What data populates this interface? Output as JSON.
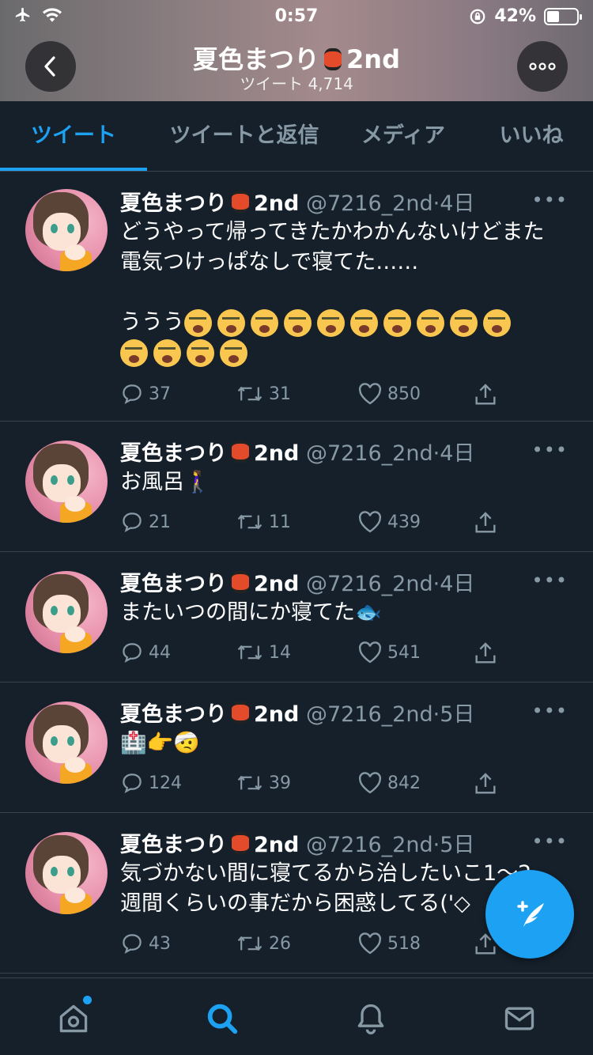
{
  "status_bar": {
    "time": "0:57",
    "battery_percent": "42%",
    "battery_level": 0.42
  },
  "header": {
    "title": "夏色まつり",
    "title_suffix": "2nd",
    "subtitle": "ツイート 4,714"
  },
  "tabs": [
    {
      "label": "ツイート",
      "active": true
    },
    {
      "label": "ツイートと返信",
      "active": false
    },
    {
      "label": "メディア",
      "active": false
    },
    {
      "label": "いいね",
      "active": false
    }
  ],
  "tweets": [
    {
      "name": "夏色まつり",
      "name_suffix": "2nd",
      "handle": "@7216_2nd",
      "time": "4日",
      "text_line1": "どうやって帰ってきたかわかんないけどまた\n電気つけっぱなしで寝てた……",
      "text_line2": "ううう",
      "emoji": "crying-face x14",
      "replies": "37",
      "retweets": "31",
      "likes": "850"
    },
    {
      "name": "夏色まつり",
      "name_suffix": "2nd",
      "handle": "@7216_2nd",
      "time": "4日",
      "text": "お風呂🚶‍♀️",
      "replies": "21",
      "retweets": "11",
      "likes": "439"
    },
    {
      "name": "夏色まつり",
      "name_suffix": "2nd",
      "handle": "@7216_2nd",
      "time": "4日",
      "text": "またいつの間にか寝てた🐟",
      "replies": "44",
      "retweets": "14",
      "likes": "541"
    },
    {
      "name": "夏色まつり",
      "name_suffix": "2nd",
      "handle": "@7216_2nd",
      "time": "5日",
      "text": "🏥👉🤕",
      "replies": "124",
      "retweets": "39",
      "likes": "842"
    },
    {
      "name": "夏色まつり",
      "name_suffix": "2nd",
      "handle": "@7216_2nd",
      "time": "5日",
      "text": "気づかない間に寝てるから治したいこ1〜2\n週間くらいの事だから困惑してる('◇",
      "replies": "43",
      "retweets": "26",
      "likes": "518"
    }
  ],
  "icons": {
    "back": "chevron-left-icon",
    "more": "ellipsis-icon",
    "reply": "speech-bubble-icon",
    "retweet": "retweet-icon",
    "like": "heart-icon",
    "share": "share-icon",
    "compose": "quill-icon",
    "home": "home-icon",
    "search": "search-icon",
    "notifications": "bell-icon",
    "messages": "envelope-icon"
  },
  "colors": {
    "accent": "#1da1f2",
    "background": "#15202b",
    "muted": "#8899a6",
    "divider": "#38444d"
  }
}
